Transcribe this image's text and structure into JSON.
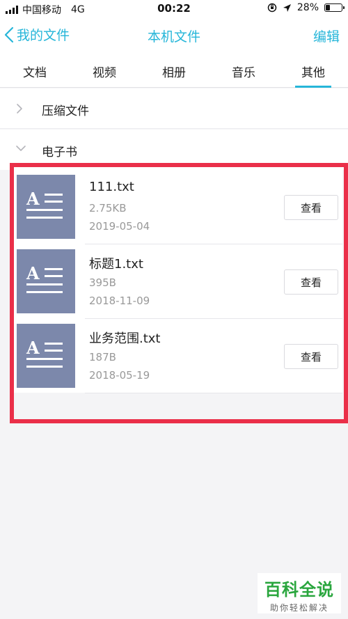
{
  "status_bar": {
    "carrier": "中国移动",
    "network": "4G",
    "time": "00:22",
    "battery": "28%",
    "battery_level": 0.28
  },
  "nav": {
    "back_label": "我的文件",
    "title": "本机文件",
    "edit_label": "编辑"
  },
  "tabs": [
    {
      "label": "文档"
    },
    {
      "label": "视频"
    },
    {
      "label": "相册"
    },
    {
      "label": "音乐"
    },
    {
      "label": "其他",
      "active": true
    }
  ],
  "folders": [
    {
      "label": "压缩文件",
      "expanded": false
    },
    {
      "label": "电子书",
      "expanded": true
    }
  ],
  "files": [
    {
      "name": "111.txt",
      "size": "2.75KB",
      "date": "2019-05-04",
      "action": "查看",
      "thumb_letter": "A"
    },
    {
      "name": "标题1.txt",
      "size": "395B",
      "date": "2018-11-09",
      "action": "查看",
      "thumb_letter": "A"
    },
    {
      "name": "业务范围.txt",
      "size": "187B",
      "date": "2018-05-19",
      "action": "查看",
      "thumb_letter": "A"
    }
  ],
  "colors": {
    "accent": "#26b6d9",
    "highlight": "#ea2f49",
    "thumb": "#7c88ab",
    "watermark_green": "#2aa63e"
  },
  "watermark": {
    "title": "百科全说",
    "subtitle": "助你轻松解决"
  }
}
